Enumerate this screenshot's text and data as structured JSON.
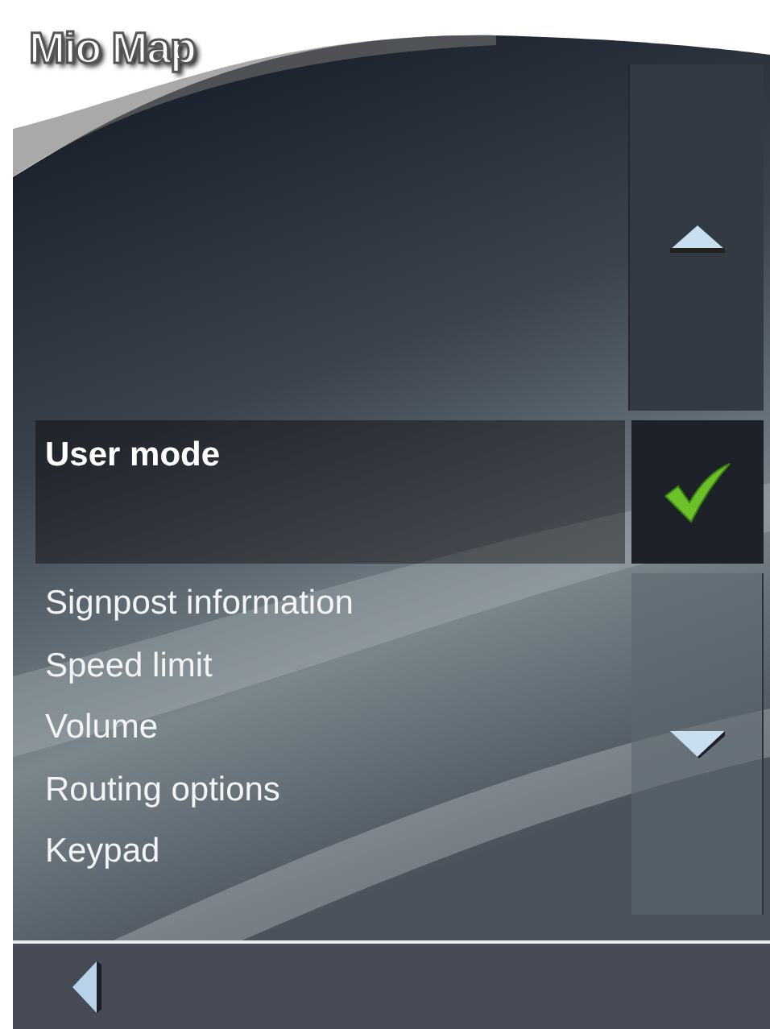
{
  "app": {
    "title": "Mio Map"
  },
  "menu": {
    "items": [
      {
        "label": "User mode",
        "selected": true
      },
      {
        "label": "Signpost information",
        "selected": false
      },
      {
        "label": "Speed limit",
        "selected": false
      },
      {
        "label": "Volume",
        "selected": false
      },
      {
        "label": "Routing options",
        "selected": false
      },
      {
        "label": "Keypad",
        "selected": false
      }
    ]
  }
}
